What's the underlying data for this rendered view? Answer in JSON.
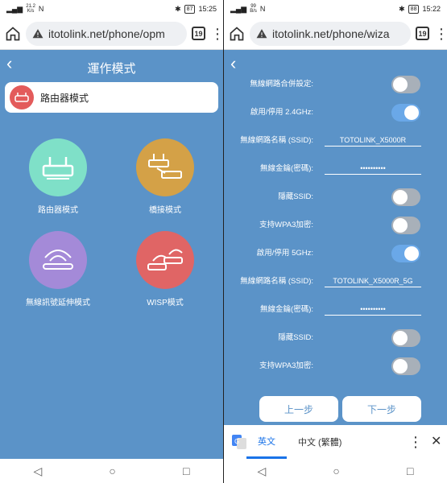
{
  "left": {
    "status": {
      "signal": "▂▄▆",
      "speed_value": "21.2",
      "speed_unit": "K/s",
      "nfc": "N",
      "bt": "✱",
      "battery": "87",
      "time": "15:25"
    },
    "url": "itotolink.net/phone/opm",
    "tab_count": "19",
    "page_title": "運作模式",
    "current_mode": "路由器模式",
    "modes": [
      {
        "label": "路由器模式",
        "color": "#7fe0c8"
      },
      {
        "label": "橋接模式",
        "color": "#d4a147"
      },
      {
        "label": "無線訊號延伸模式",
        "color": "#a48ad8"
      },
      {
        "label": "WISP模式",
        "color": "#e06565"
      }
    ]
  },
  "right": {
    "status": {
      "signal": "▂▄▆",
      "speed_value": "99",
      "speed_unit": "B/s",
      "nfc": "N",
      "bt": "✱",
      "battery": "88",
      "time": "15:22"
    },
    "url": "itotolink.net/phone/wiza",
    "tab_count": "19",
    "rows": [
      {
        "label": "無線網路合併設定:",
        "type": "toggle",
        "state": "off"
      },
      {
        "label": "啟用/停用 2.4GHz:",
        "type": "toggle",
        "state": "on"
      },
      {
        "label": "無線網路名稱 (SSID):",
        "type": "field",
        "value": "TOTOLINK_X5000R"
      },
      {
        "label": "無線金鑰(密碼):",
        "type": "field",
        "value": "••••••••••"
      },
      {
        "label": "隱藏SSID:",
        "type": "toggle",
        "state": "off"
      },
      {
        "label": "支持WPA3加密:",
        "type": "toggle",
        "state": "off"
      },
      {
        "label": "啟用/停用 5GHz:",
        "type": "toggle",
        "state": "on"
      },
      {
        "label": "無線網路名稱 (SSID):",
        "type": "field",
        "value": "TOTOLINK_X5000R_5G"
      },
      {
        "label": "無線金鑰(密碼):",
        "type": "field",
        "value": "••••••••••"
      },
      {
        "label": "隱藏SSID:",
        "type": "toggle",
        "state": "off"
      },
      {
        "label": "支持WPA3加密:",
        "type": "toggle",
        "state": "off"
      }
    ],
    "prev_button": "上一步",
    "next_button": "下一步",
    "translate": {
      "lang_en": "英文",
      "lang_zh": "中文 (繁體)"
    }
  },
  "icons": {
    "home": "home-icon",
    "warning": "warning-icon",
    "menu": "more-vert-icon",
    "back": "back-icon",
    "close": "close-icon"
  }
}
